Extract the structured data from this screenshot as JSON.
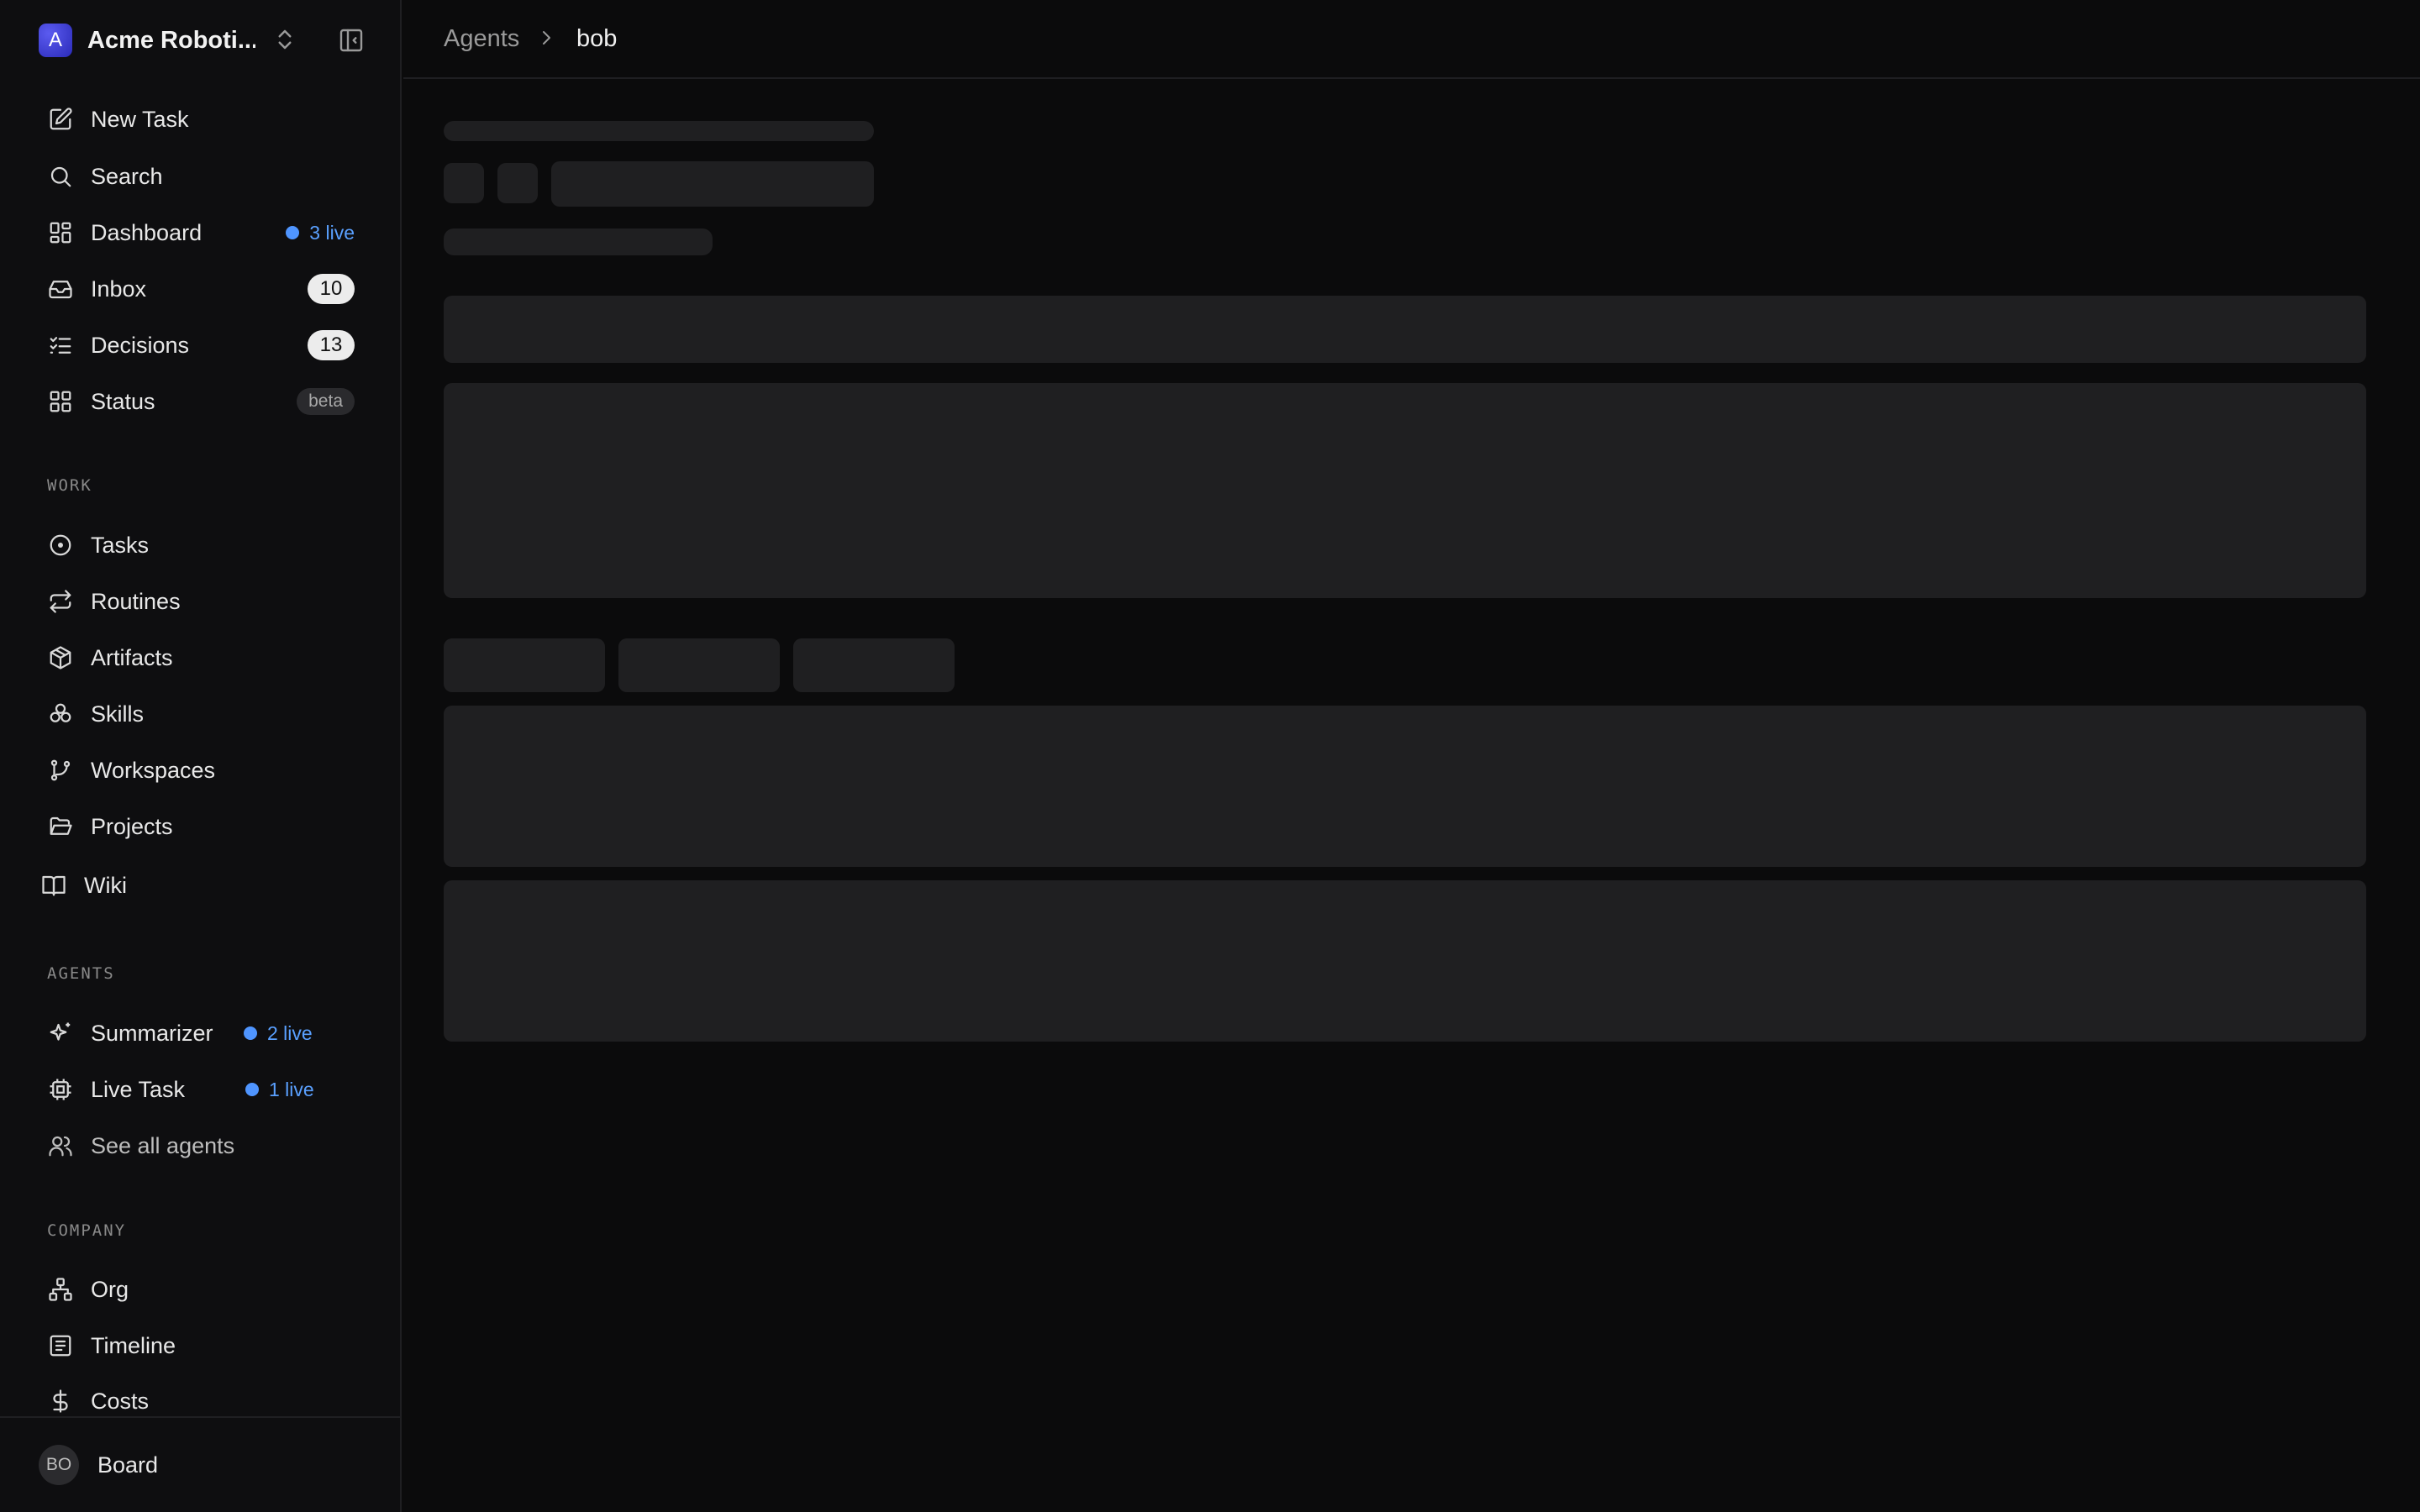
{
  "company": {
    "logo_letter": "A",
    "name": "Acme Roboti..."
  },
  "nav": {
    "new_task": "New Task",
    "search": "Search",
    "dashboard": "Dashboard",
    "dashboard_live": "3 live",
    "inbox": "Inbox",
    "inbox_count": "10",
    "decisions": "Decisions",
    "decisions_count": "13",
    "status": "Status",
    "status_badge": "beta"
  },
  "work": {
    "header": "WORK",
    "tasks": "Tasks",
    "routines": "Routines",
    "artifacts": "Artifacts",
    "skills": "Skills",
    "workspaces": "Workspaces",
    "projects": "Projects",
    "wiki": "Wiki"
  },
  "agents": {
    "header": "AGENTS",
    "summarizer": "Summarizer",
    "summarizer_live": "2 live",
    "live_task": "Live Task",
    "live_task_live": "1 live",
    "see_all": "See all agents"
  },
  "company_section": {
    "header": "COMPANY",
    "org": "Org",
    "timeline": "Timeline",
    "costs": "Costs"
  },
  "footer": {
    "avatar": "BO",
    "label": "Board"
  },
  "breadcrumb": {
    "parent": "Agents",
    "current": "bob"
  },
  "colors": {
    "accent_live": "#4f95ff",
    "background": "#0b0b0c",
    "skeleton": "#1f1f21"
  },
  "icons": [
    "chevron-up-down-icon",
    "sidebar-collapse-icon",
    "edit-icon",
    "search-icon",
    "dashboard-icon",
    "inbox-icon",
    "list-check-icon",
    "grid-icon",
    "circle-dot-icon",
    "repeat-icon",
    "box-icon",
    "skills-icon",
    "git-branch-icon",
    "folder-icon",
    "book-icon",
    "sparkle-icon",
    "cpu-icon",
    "users-icon",
    "org-icon",
    "timeline-icon",
    "dollar-icon",
    "chevron-right-icon"
  ]
}
